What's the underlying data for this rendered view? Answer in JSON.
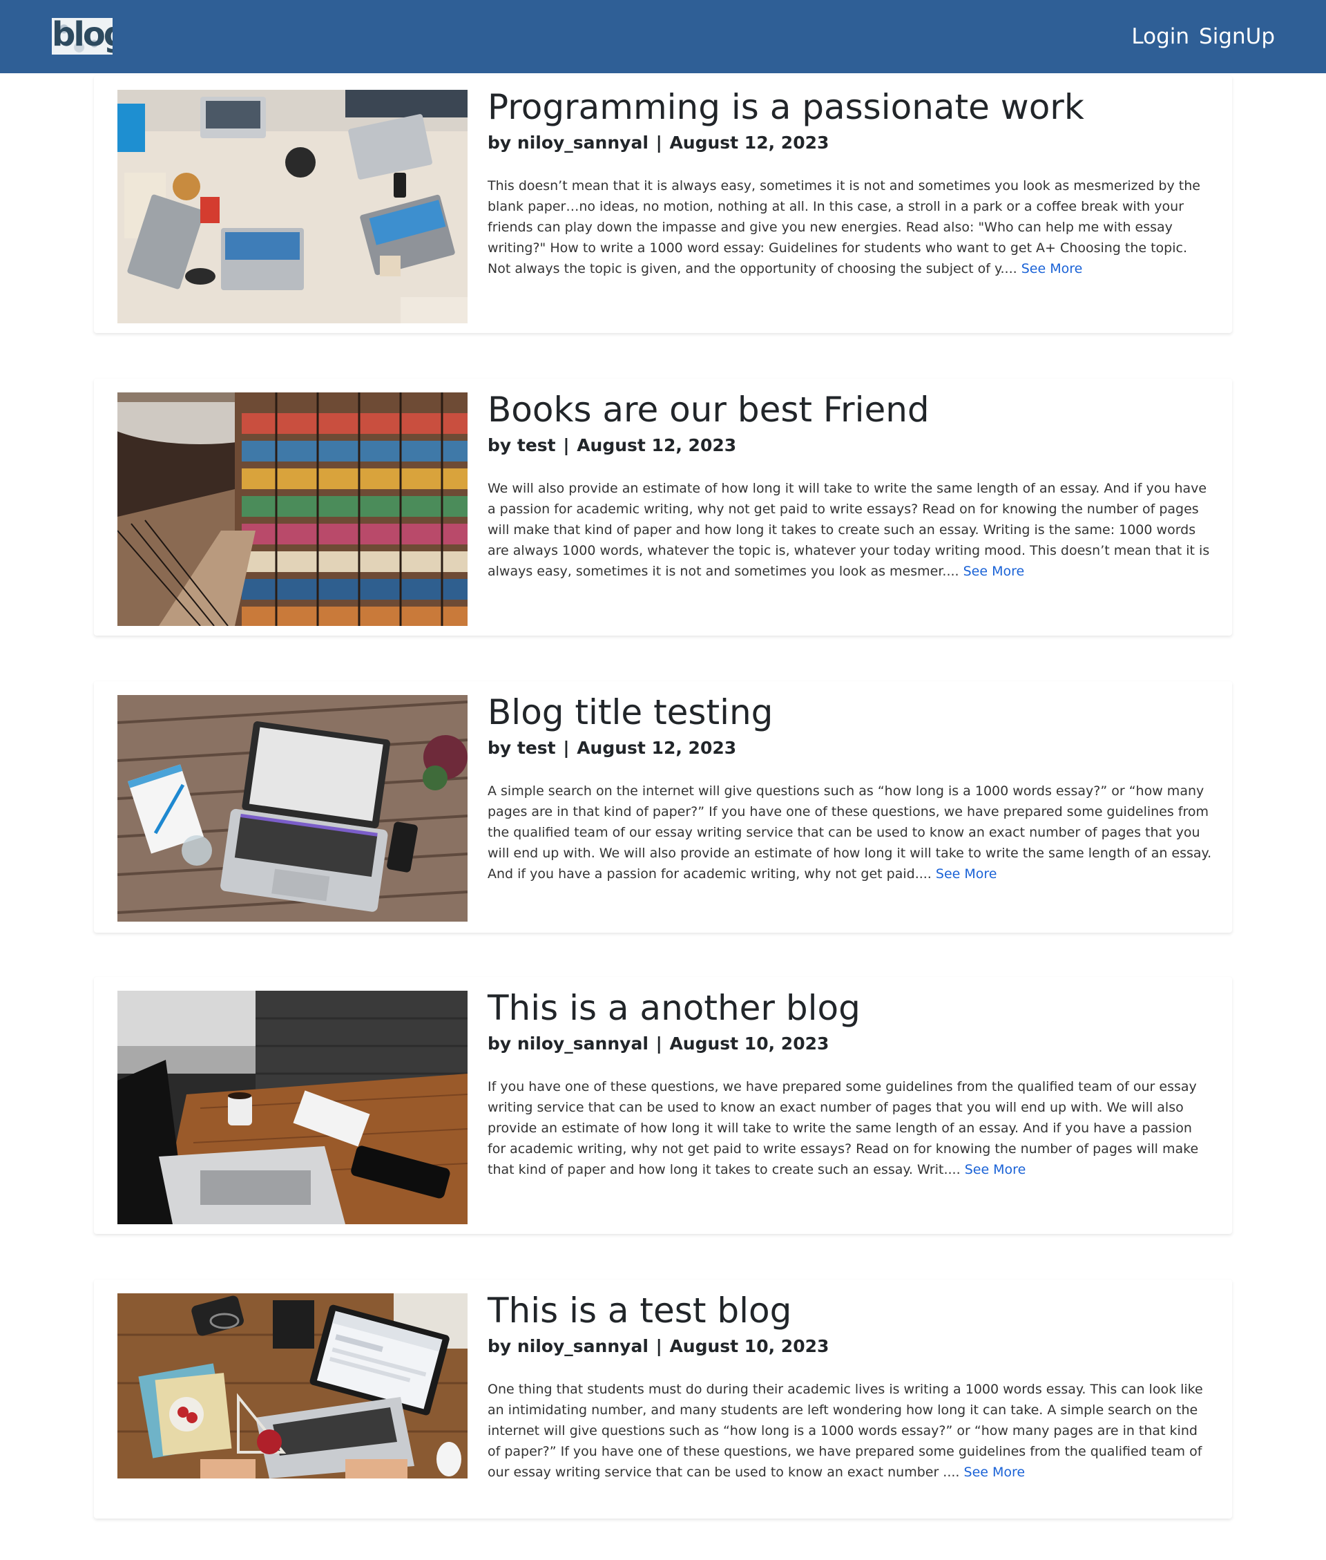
{
  "nav": {
    "logo_text": "blog",
    "login": "Login",
    "signup": "SignUp"
  },
  "posts": [
    {
      "title": "Programming is a passionate work",
      "author": "by niloy_sannyal",
      "date": "August 12, 2023",
      "excerpt": "This doesn’t mean that it is always easy, sometimes it is not and sometimes you look as mesmerized by the blank paper…no ideas, no motion, nothing at all. In this case, a stroll in a park or a coffee break with your friends can play down the impasse and give you new energies. Read also: \"Who can help me with essay writing?\" How to write a 1000 word essay: Guidelines for students who want to get A+ Choosing the topic. Not always the topic is given, and the opportunity of choosing the subject of y....",
      "see_more": "See More",
      "image": "laptops-on-desk"
    },
    {
      "title": "Books are our best Friend",
      "author": "by test",
      "date": "August 12, 2023",
      "excerpt": "We will also provide an estimate of how long it will take to write the same length of an essay. And if you have a passion for academic writing, why not get paid to write essays? Read on for knowing the number of pages will make that kind of paper and how long it takes to create such an essay. Writing is the same: 1000 words are always 1000 words, whatever the topic is, whatever your today writing mood. This doesn’t mean that it is always easy, sometimes it is not and sometimes you look as mesmer....",
      "see_more": "See More",
      "image": "library-bookshelves"
    },
    {
      "title": "Blog title testing",
      "author": "by test",
      "date": "August 12, 2023",
      "excerpt": "A simple search on the internet will give questions such as “how long is a 1000 words essay?” or “how many pages are in that kind of paper?” If you have one of these questions, we have prepared some guidelines from the qualified team of our essay writing service that can be used to know an exact number of pages that you will end up with. We will also provide an estimate of how long it will take to write the same length of an essay. And if you have a passion for academic writing, why not get paid....",
      "see_more": "See More",
      "image": "laptop-on-wood"
    },
    {
      "title": "This is a another blog",
      "author": "by niloy_sannyal",
      "date": "August 10, 2023",
      "excerpt": "If you have one of these questions, we have prepared some guidelines from the qualified team of our essay writing service that can be used to know an exact number of pages that you will end up with. We will also provide an estimate of how long it will take to write the same length of an essay. And if you have a passion for academic writing, why not get paid to write essays? Read on for knowing the number of pages will make that kind of paper and how long it takes to create such an essay. Writ....",
      "see_more": "See More",
      "image": "laptop-coffee-desk"
    },
    {
      "title": "This is a test blog",
      "author": "by niloy_sannyal",
      "date": "August 10, 2023",
      "excerpt": "One thing that students must do during their academic lives is writing a 1000 words essay. This can look like an intimidating number, and many students are left wondering how long it can take. A simple search on the internet will give questions such as “how long is a 1000 words essay?” or “how many pages are in that kind of paper?” If you have one of these questions, we have prepared some guidelines from the qualified team of our essay writing service that can be used to know an exact number ....",
      "see_more": "See More",
      "image": "blog-laptop-workspace"
    }
  ]
}
